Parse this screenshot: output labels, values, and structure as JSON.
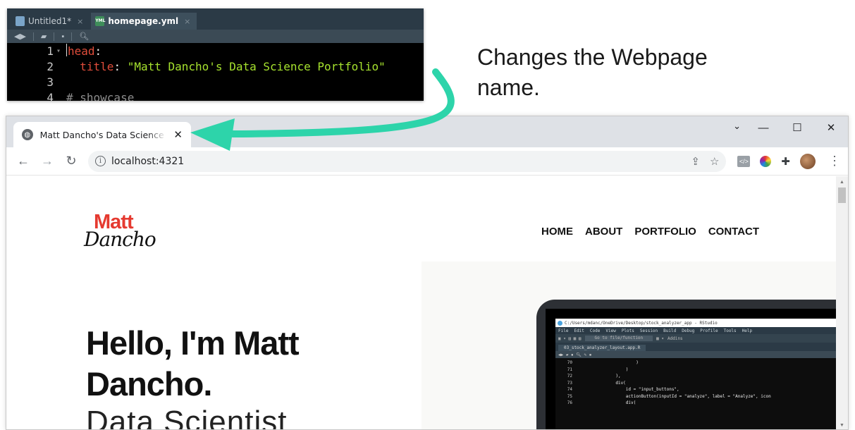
{
  "editor": {
    "tabs": [
      {
        "label": "Untitled1*",
        "close": "×",
        "icon": "r-file-icon"
      },
      {
        "label": "homepage.yml",
        "close": "×",
        "icon": "yml-file-icon"
      }
    ],
    "lines": [
      {
        "num": "1",
        "key": "head",
        "rest": ":"
      },
      {
        "num": "2",
        "key": "title",
        "rest": ": ",
        "value": "\"Matt Dancho's Data Science Portfolio\""
      },
      {
        "num": "3"
      },
      {
        "num": "4",
        "comment": "# showcase"
      }
    ]
  },
  "annotation": {
    "text": "Changes the Webpage name.",
    "arrow_color": "#2dd4aa"
  },
  "browser": {
    "tab_title": "Matt Dancho's Data Science Portfolio",
    "tab_close": "✕",
    "new_tab": "+",
    "url": "localhost:4321",
    "window_controls": {
      "tab_search": "⌄",
      "minimize": "—",
      "maximize": "☐",
      "close": "✕"
    }
  },
  "site": {
    "logo": {
      "line1": "Matt",
      "line2": "Dancho",
      "accent": "#e53a30"
    },
    "nav": [
      "HOME",
      "ABOUT",
      "PORTFOLIO",
      "CONTACT"
    ],
    "hero": {
      "heading": "Hello, I'm Matt Dancho.",
      "subheading": "Data Scientist"
    },
    "rstudio": {
      "title": "C:/Users/mdanc/OneDrive/Desktop/stock_analyzer_app - RStudio",
      "menu": [
        "File",
        "Edit",
        "Code",
        "View",
        "Plots",
        "Session",
        "Build",
        "Debug",
        "Profile",
        "Tools",
        "Help"
      ],
      "goto": "Go to file/function",
      "addins": "Addins",
      "file_tab": "03_stock_analyzer_layout.app.R",
      "lines": [
        {
          "num": "70",
          "code": "                    )"
        },
        {
          "num": "71",
          "code": "                )"
        },
        {
          "num": "72",
          "code": "            ),"
        },
        {
          "num": "73",
          "code": "            div("
        },
        {
          "num": "74",
          "code": "                id = \"input_buttons\","
        },
        {
          "num": "75",
          "code": "                actionButton(inputId = \"analyze\", label = \"Analyze\", icon"
        },
        {
          "num": "76",
          "code": "                div("
        }
      ]
    }
  }
}
